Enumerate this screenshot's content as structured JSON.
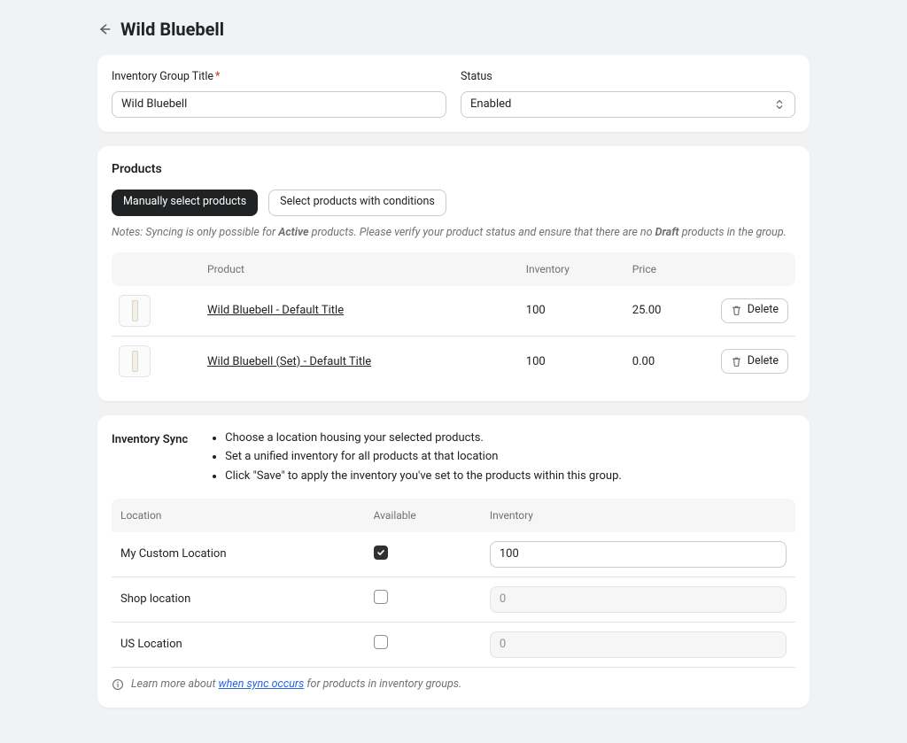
{
  "header": {
    "title": "Wild Bluebell"
  },
  "groupForm": {
    "titleLabel": "Inventory Group Title",
    "titleValue": "Wild Bluebell",
    "statusLabel": "Status",
    "statusValue": "Enabled"
  },
  "productsSection": {
    "title": "Products",
    "tabs": {
      "manual": "Manually select products",
      "conditions": "Select products with conditions"
    },
    "note_prefix": "Notes: Syncing is only possible for ",
    "note_active": "Active",
    "note_mid": " products. Please verify your product status and ensure that there are no ",
    "note_draft": "Draft",
    "note_suffix": " products in the group.",
    "columns": {
      "product": "Product",
      "inventory": "Inventory",
      "price": "Price"
    },
    "deleteLabel": "Delete",
    "rows": [
      {
        "name": "Wild Bluebell - Default Title",
        "inventory": "100",
        "price": "25.00"
      },
      {
        "name": "Wild Bluebell (Set) - Default Title",
        "inventory": "100",
        "price": "0.00"
      }
    ]
  },
  "syncSection": {
    "title": "Inventory Sync",
    "bullets": [
      "Choose a location housing your selected products.",
      "Set a unified inventory for all products at that location",
      "Click \"Save\" to apply the inventory you've set to the products within this group."
    ],
    "columns": {
      "location": "Location",
      "available": "Available",
      "inventory": "Inventory"
    },
    "rows": [
      {
        "location": "My Custom Location",
        "checked": true,
        "inventory": "100"
      },
      {
        "location": "Shop location",
        "checked": false,
        "inventory": "0"
      },
      {
        "location": "US Location",
        "checked": false,
        "inventory": "0"
      }
    ],
    "footer_prefix": "Learn more about ",
    "footer_link": "when sync occurs",
    "footer_suffix": " for products in inventory groups."
  }
}
